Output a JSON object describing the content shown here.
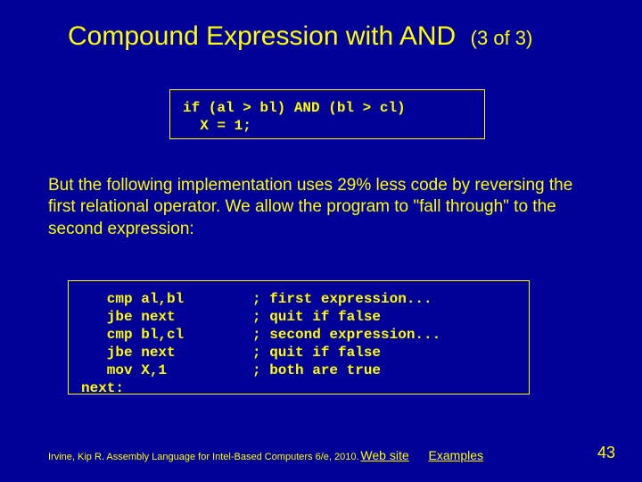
{
  "title": {
    "main": "Compound Expression with AND",
    "sub": "(3 of 3)"
  },
  "code_box1": "if (al > bl) AND (bl > cl)\n  X = 1;",
  "body_text": "But the following implementation uses  29% less code by reversing the first relational operator. We allow the program to \"fall through\" to the second expression:",
  "code_box2_left": "   cmp al,bl\n   jbe next\n   cmp bl,cl\n   jbe next\n   mov X,1\nnext:",
  "code_box2_right": "; first expression...\n; quit if false\n; second expression...\n; quit if false\n; both are true",
  "footer": {
    "credit": "Irvine, Kip R. Assembly Language for Intel-Based Computers 6/e, 2010.",
    "link1": "Web site",
    "link2": "Examples",
    "page": "43"
  }
}
